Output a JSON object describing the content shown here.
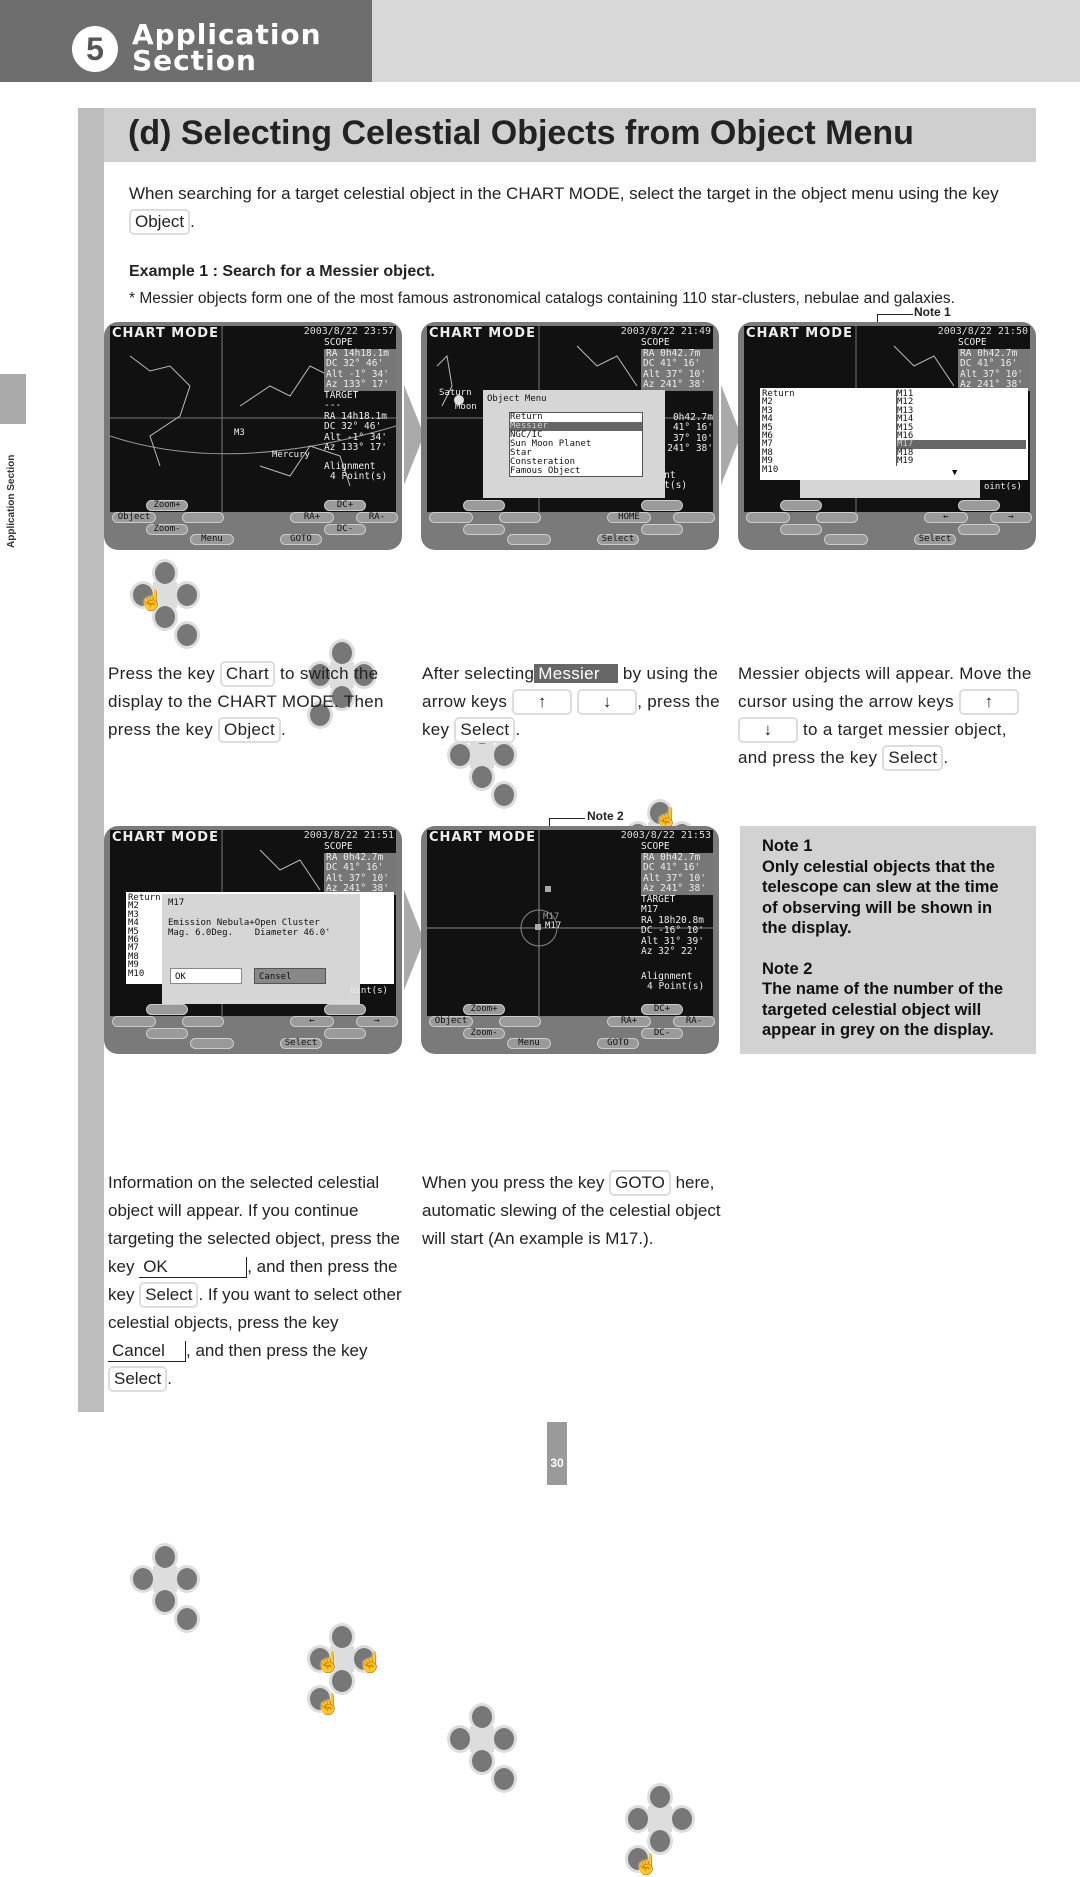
{
  "header": {
    "section_number": "5",
    "section_title_line1": "Application",
    "section_title_line2": "Section"
  },
  "side_label": "Application Section",
  "title": "(d) Selecting Celestial Objects from Object Menu",
  "intro": {
    "text_before": "When searching for a target celestial object in the CHART MODE, select the target in the object menu using the key",
    "key": "Object",
    "text_after": "."
  },
  "example": {
    "heading": "Example 1 : Search for a Messier object.",
    "footnote": "* Messier objects form one of the most famous astronomical catalogs containing 110 star-clusters, nebulae and galaxies."
  },
  "note_labels": {
    "note1": "Note 1",
    "note2": "Note 2"
  },
  "screens": [
    {
      "title": "CHART MODE",
      "date": "2003/8/22 23:57",
      "scope": [
        "SCOPE",
        "RA 14h18.1m",
        "DC  32° 46'",
        "Alt  -1° 34'",
        "Az  133° 17'"
      ],
      "target": [
        "TARGET",
        "---",
        "RA 14h18.1m",
        "DC  32° 46'",
        "Alt  -1° 34'",
        "Az  133° 17'"
      ],
      "alignment": [
        "Alignment",
        "4 Point(s)"
      ],
      "labels": [
        "M3",
        "Mercury"
      ],
      "buttons": [
        "Zoom+",
        "Object",
        "Zoom-",
        "Menu",
        "GOTO",
        "DC+",
        "RA+",
        "RA-",
        "DC-"
      ]
    },
    {
      "title": "CHART MODE",
      "date": "2003/8/22 21:49",
      "scope": [
        "SCOPE",
        "RA  0h42.7m",
        "DC  41° 16'",
        "Alt  37° 10'",
        "Az  241° 38'"
      ],
      "target": [
        "0h42.7m",
        "41° 16'",
        "37° 10'",
        "241° 38'"
      ],
      "alignment": [
        "nment",
        "oint(s)"
      ],
      "labels": [
        "Saturn",
        "Moon"
      ],
      "menu_title": "Object Menu",
      "menu_items": [
        "Return",
        "Messier",
        "NGC/IC",
        "Sun Moon Planet",
        "Star",
        "Consteration",
        "Famous Object"
      ],
      "menu_selected": 1,
      "buttons": [
        "HOME",
        "Select"
      ]
    },
    {
      "title": "CHART MODE",
      "date": "2003/8/22 21:50",
      "scope": [
        "SCOPE",
        "RA  0h42.7m",
        "DC  41° 16'",
        "Alt  37° 10'",
        "Az  241° 38'"
      ],
      "list_left": [
        "Return",
        "M2",
        "M3",
        "M4",
        "M5",
        "M6",
        "M7",
        "M8",
        "M9",
        "M10"
      ],
      "list_right": [
        "M11",
        "M12",
        "M13",
        "M14",
        "M15",
        "M16",
        "M17",
        "M18",
        "M19"
      ],
      "list_selected": "M17",
      "alignment": [
        "oint(s)"
      ],
      "buttons": [
        "←",
        "→",
        "Select"
      ]
    },
    {
      "title": "CHART MODE",
      "date": "2003/8/22 21:51",
      "scope": [
        "SCOPE",
        "RA  0h42.7m",
        "DC  41° 16'",
        "Alt  37° 10'",
        "Az  241° 38'"
      ],
      "list_left": [
        "Return",
        "M2",
        "M3",
        "M4",
        "M5",
        "M6",
        "M7",
        "M8",
        "M9",
        "M10"
      ],
      "dialog_name": "M17",
      "dialog_line1": "Emission Nebula+Open Cluster",
      "dialog_line2": "Mag. 6.0Deg.    Diameter 46.0'",
      "ok": "OK",
      "cancel": "Cansel",
      "alignment": [
        "oint(s)"
      ],
      "buttons": [
        "←",
        "→",
        "Select"
      ]
    },
    {
      "title": "CHART MODE",
      "date": "2003/8/22 21:53",
      "scope": [
        "SCOPE",
        "RA  0h42.7m",
        "DC  41° 16'",
        "Alt  37° 10'",
        "Az  241° 38'"
      ],
      "target": [
        "TARGET",
        "M17",
        "RA 18h20.8m",
        "DC -16° 10'",
        "Alt  31° 39'",
        "Az   32° 22'"
      ],
      "alignment": [
        "Alignment",
        "4 Point(s)"
      ],
      "labels": [
        "M17",
        "M17"
      ],
      "buttons": [
        "Zoom+",
        "Object",
        "Zoom-",
        "Menu",
        "GOTO",
        "DC+",
        "RA+",
        "RA-",
        "DC-"
      ]
    }
  ],
  "steps": {
    "s1": {
      "t1": "Press the key",
      "k1": "Chart",
      "t2": "to switch the display to the CHART MODE. Then press the key",
      "k2": "Object",
      "t3": "."
    },
    "s2": {
      "t1": "After selecting",
      "hl": "Messier",
      "t2": "by using the arrow keys",
      "up": "↑",
      "down": "↓",
      "t3": ", press the key",
      "k": "Select",
      "t4": "."
    },
    "s3": {
      "t1": "Messier objects will appear. Move the cursor using the arrow keys",
      "up": "↑",
      "down": "↓",
      "t2": "to a target messier object, and press the key",
      "k": "Select",
      "t3": "."
    },
    "s4": {
      "t1": "Information on the selected celestial object will appear. If you continue targeting the selected object, press the key",
      "ok": "OK",
      "t2": ", and then press the key",
      "k1": "Select",
      "t3": ". If you want to select other celestial objects, press the key",
      "cancel": "Cancel",
      "t4": ", and then press the key",
      "k2": "Select",
      "t5": "."
    },
    "s5": {
      "t1": "When you press the key",
      "k": "GOTO",
      "t2": "here, automatic slewing of the celestial object will start (An example is M17.)."
    }
  },
  "notes": [
    {
      "title": "Note 1",
      "body": "Only celestial objects that the telescope can slew at the time of observing will be shown in the display."
    },
    {
      "title": "Note 2",
      "body": "The name of the number of the targeted celestial object will appear in grey on the display."
    }
  ],
  "page_number": "30"
}
